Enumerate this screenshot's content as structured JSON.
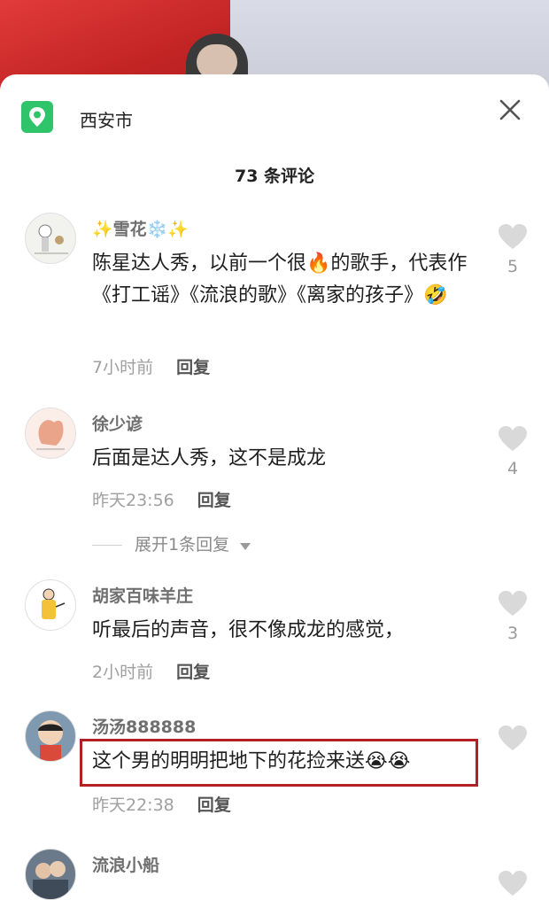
{
  "location": {
    "name": "西安市",
    "icon": "location-pin-icon"
  },
  "header": {
    "title": "73 条评论"
  },
  "comments": [
    {
      "username": "✨雪花❄️✨",
      "text": "陈星达人秀，以前一个很🔥的歌手，代表作《打工谣》《流浪的歌》《离家的孩子》🤣",
      "time": "7小时前",
      "reply_label": "回复",
      "likes": "5"
    },
    {
      "username": "徐少谚",
      "text": "后面是达人秀，这不是成龙",
      "time": "昨天23:56",
      "reply_label": "回复",
      "likes": "4",
      "expand_label": "展开1条回复"
    },
    {
      "username": "胡家百味羊庄",
      "text": "听最后的声音，很不像成龙的感觉，",
      "time": "2小时前",
      "reply_label": "回复",
      "likes": "3"
    },
    {
      "username": "汤汤888888",
      "text": "这个男的明明把地下的花捡来送😭😭",
      "time": "昨天22:38",
      "reply_label": "回复",
      "likes": ""
    },
    {
      "username": "流浪小船",
      "text": "",
      "time": "",
      "reply_label": "",
      "likes": ""
    }
  ],
  "colors": {
    "accent_green": "#2fc46a",
    "highlight_red": "#b22026"
  }
}
